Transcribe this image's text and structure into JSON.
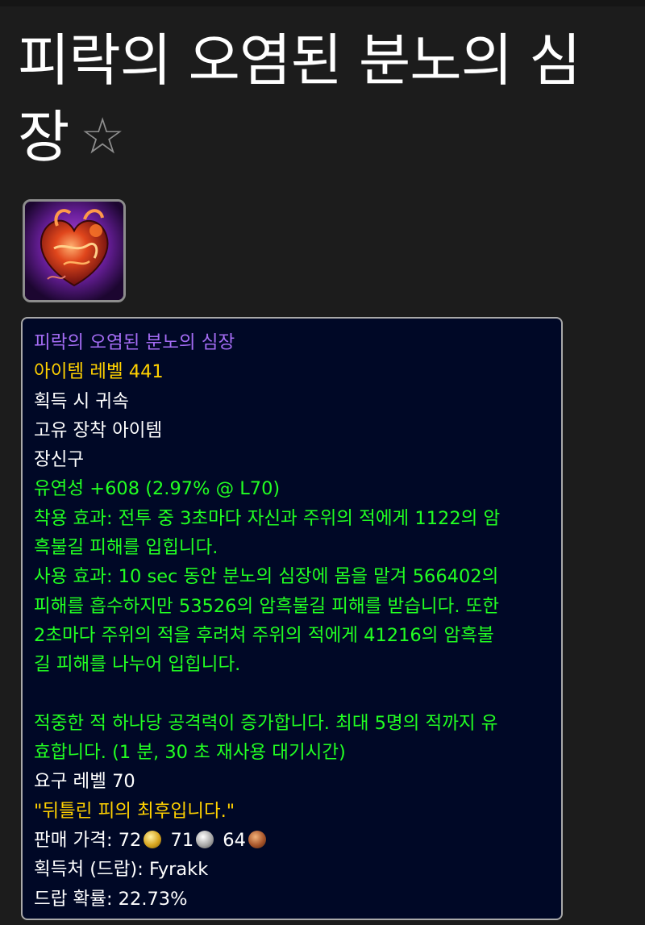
{
  "page": {
    "title": "피락의 오염된 분노의 심장",
    "favorite_icon": "star-outline-icon"
  },
  "item_icon": "burning-heart-icon",
  "tooltip": {
    "name": "피락의 오염된 분노의 심장",
    "item_level": "아이템 레벨 441",
    "binding": "획득 시 귀속",
    "unique": "고유 장착 아이템",
    "slot": "장신구",
    "stat": "유연성 +608 (2.97% @ L70)",
    "equip_effect": [
      "착용 효과: 전투 중 3초마다 자신과 주위의 적에게 1122의 암",
      "흑불길 피해를 입힙니다."
    ],
    "use_effect": [
      "사용 효과: 10 sec 동안 분노의 심장에 몸을 맡겨 566402의",
      "피해를 흡수하지만 53526의 암흑불길 피해를 받습니다. 또한",
      "2초마다 주위의 적을 후려쳐 주위의 적에게 41216의 암흑불",
      "길 피해를 나누어 입힙니다."
    ],
    "use_effect_extra": [
      "적중한 적 하나당 공격력이 증가합니다. 최대 5명의 적까지 유",
      "효합니다. (1 분, 30 초 재사용 대기시간)"
    ],
    "required_level": "요구 레벨 70",
    "flavor": "\"뒤틀린 피의 최후입니다.\"",
    "sell_price": {
      "label": "판매 가격:",
      "gold": "72",
      "silver": "71",
      "copper": "64"
    },
    "source": "획득처 (드랍): Fyrakk",
    "drop_chance": "드랍 확률: 22.73%"
  },
  "colors": {
    "epic": "#a46cf4",
    "item_level": "#ffd100",
    "effect": "#22ff22",
    "tooltip_bg": "#000826"
  }
}
